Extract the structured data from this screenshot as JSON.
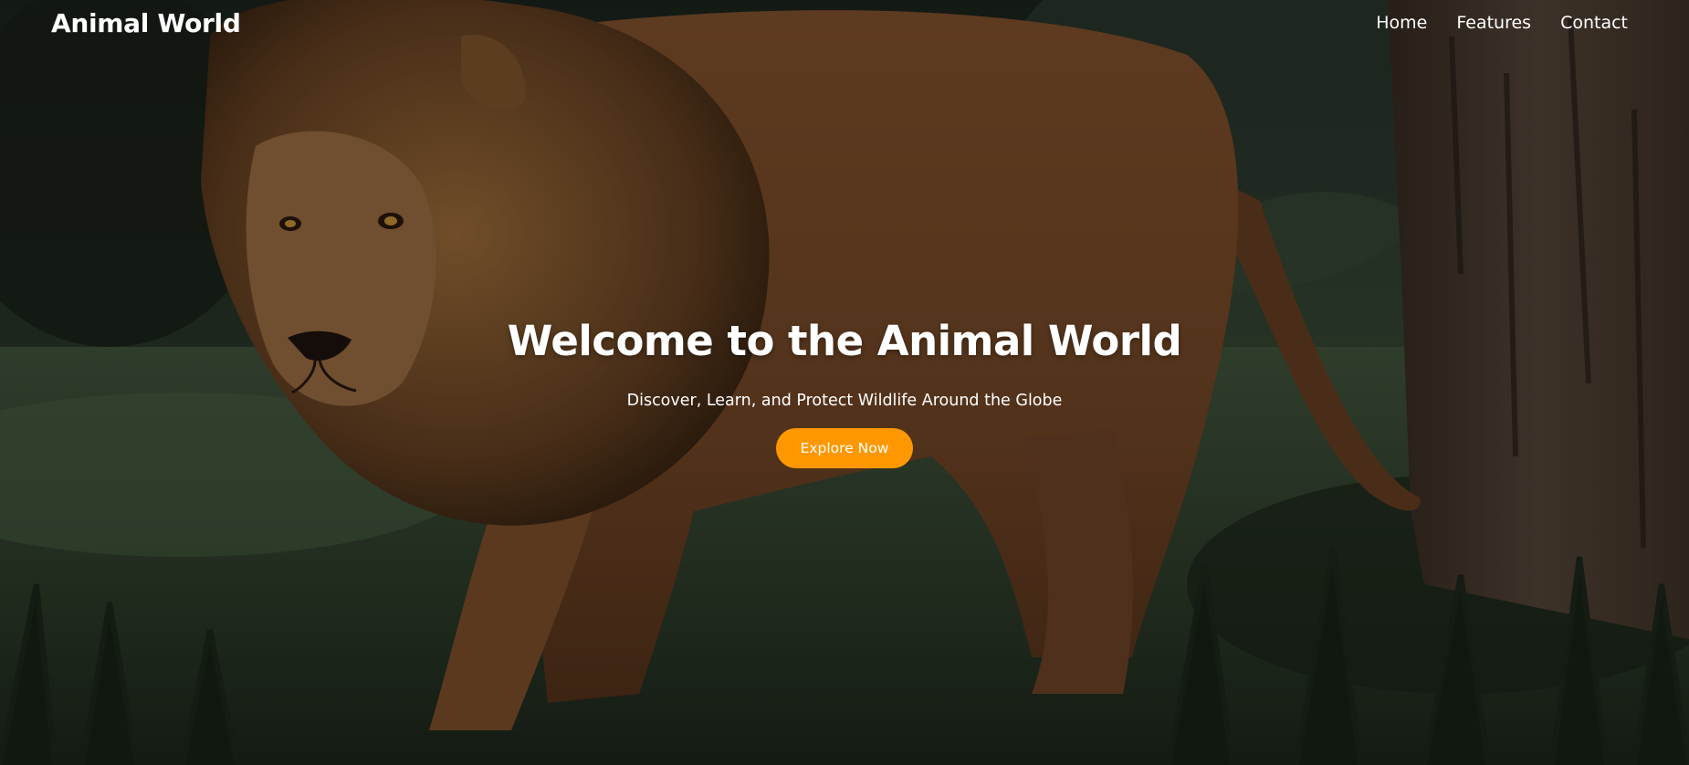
{
  "header": {
    "brand": "Animal World",
    "nav": [
      {
        "label": "Home"
      },
      {
        "label": "Features"
      },
      {
        "label": "Contact"
      }
    ]
  },
  "hero": {
    "title": "Welcome to the Animal World",
    "subtitle": "Discover, Learn, and Protect Wildlife Around the Globe",
    "cta_label": "Explore Now",
    "background_image": "lion-walking-in-grass",
    "overlay_color": "#000000"
  },
  "colors": {
    "accent": "#ff9800",
    "text": "#ffffff"
  }
}
